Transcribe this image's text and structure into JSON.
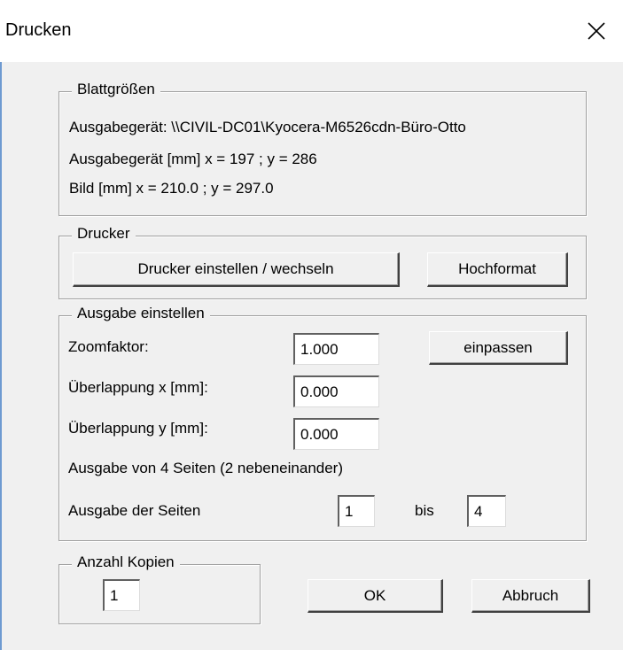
{
  "window": {
    "title": "Drucken"
  },
  "blattgroessen": {
    "legend": "Blattgrößen",
    "line1": "Ausgabegerät: \\\\CIVIL-DC01\\Kyocera-M6526cdn-Büro-Otto",
    "line2": "Ausgabegerät [mm]   x = 197 ; y = 286",
    "line3": "Bild [mm]   x = 210.0 ; y = 297.0"
  },
  "drucker": {
    "legend": "Drucker",
    "setup_label": "Drucker einstellen / wechseln",
    "orientation_label": "Hochformat"
  },
  "ausgabe": {
    "legend": "Ausgabe einstellen",
    "zoom_label": "Zoomfaktor:",
    "zoom_value": "1.000",
    "fit_label": "einpassen",
    "overlap_x_label": "Überlappung x [mm]:",
    "overlap_x_value": "0.000",
    "overlap_y_label": "Überlappung y [mm]:",
    "overlap_y_value": "0.000",
    "pages_info": "Ausgabe von 4 Seiten (2 nebeneinander)",
    "pages_label": "Ausgabe der Seiten",
    "from_value": "1",
    "to_label": "bis",
    "to_value": "4"
  },
  "kopien": {
    "legend": "Anzahl Kopien",
    "value": "1"
  },
  "buttons": {
    "ok": "OK",
    "cancel": "Abbruch"
  }
}
